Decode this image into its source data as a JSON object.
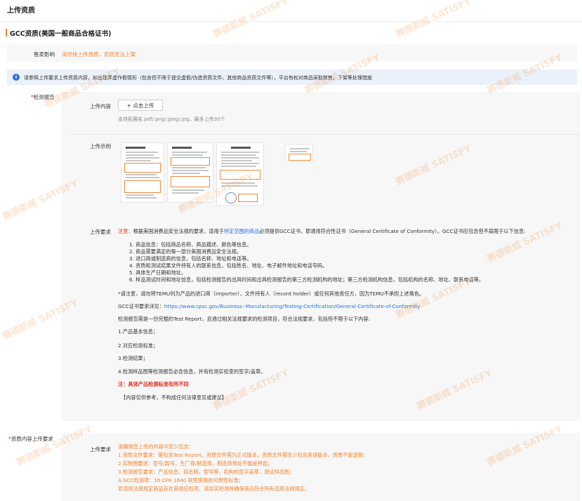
{
  "page_title": "上传资质",
  "section_title": "GCC资质(美国一般商品合格证书)",
  "sales_impact": {
    "label": "售卖影响",
    "value": "请尽快上传资质，否则无法上架"
  },
  "notice": "请参照上传要求上传资质内容，如出现弄虚作假情形（包含但不限于提交虚假/伪造资质文件、其他商品资质文件等），平台有权对商品采取禁售，下架等处理措施",
  "test_report": {
    "required_mark": "*",
    "label": "检测报告",
    "upload_label": "上传内容",
    "upload_button": "+ 点击上传",
    "upload_hint": "支持拓展名.pdf/.png/.jpeg/.jpg，最多上传30个",
    "example_label": "上传示例",
    "example_icons": [
      "document-thumbnail-icon",
      "document-thumbnail-icon",
      "document-thumbnail-icon",
      "document-thumbnail-icon"
    ],
    "req_label": "上传要求",
    "req_note_prefix": "注意：",
    "req_intro_1": "根据美国消费品安全法规的要求，适用于",
    "req_intro_link": "特定范围的商品",
    "req_intro_2": "必须提供GCC证书，即通用符合性证书（General Certificate of Conformity）。GCC证书应包含但不局限于以下信息:",
    "items": [
      "1. 商品信息：包括商品名称、商品描述、颜色等信息。",
      "2. 商品需要满足的每一部分美国消费品安全法规。",
      "3. 进口商或制造商的信息，包括名称、地址和电话等。",
      "4. 资质和测试结果文件持有人的联系信息，包括姓名、地址、电子邮件地址和电话号码。",
      "5. 具体生产日期和地址。",
      "6. 样品测试时间和地址信息，包括检测报告的出具时间和出具检测报告的第三方检测机构的地址；第三方检测机构信息，包括机构的名称、地址、联系电话等。"
    ],
    "importer_note": "*请注意，请勿将TEMU列为产品的进口商（importer），文件持有人（record holder）或任何其他责任方，因为TEMU不承担上述角色。",
    "gcc_detail_label": "GCC证书要求详见：",
    "gcc_detail_link": "https://www.cpsc.gov/Business--Manufacturing/Testing-Certification/General-Certificate-of-Conformity",
    "report_intro": "检测报告需是一份完整的Test Report，且通过相关法规要求的检测项目，符合法规要求，包括但不限于以下内容:",
    "report_items": [
      "1.产品基本信息；",
      "2.对应检测标准；",
      "3.检测结果；",
      "4.检测样品图等检测报告必含信息，并有检测实验室的签字/盖章。"
    ],
    "standard_note": "注：具体产品检测标准有所不同",
    "disclaimer": "【内容仅供参考，不构成任何法律意见或建议】"
  },
  "qualification_requirements": {
    "required_mark": "*",
    "label": "资质内容上传要求",
    "req_label": "上传要求",
    "lines": [
      "请确保您上传的内容中至少包含：",
      "1.资质文件要求：需包含Test Report，资质文件需为正式版本，资质文件需至少包含英语版本，资质不能造假；",
      "2.实物图要求：型号/款号，生厂商/制造商，制造商地址不能是拼音；",
      "3.检测报告要求：产品信息，如名称，型号等，机构的签字盖章，测试样品图；",
      "4.GCC检测项：16 CFR 1640 软垫家具的可燃性标准；",
      "若适用法规规定商品存在其他应检项，请如实检测并确保商品符合所有适用法规规定。"
    ]
  },
  "watermark": "赛德斯威 SATISFY",
  "colors": {
    "accent": "#f5822a",
    "required": "#e0301e",
    "link": "#2f6fdb",
    "info": "#2f6fdb"
  }
}
